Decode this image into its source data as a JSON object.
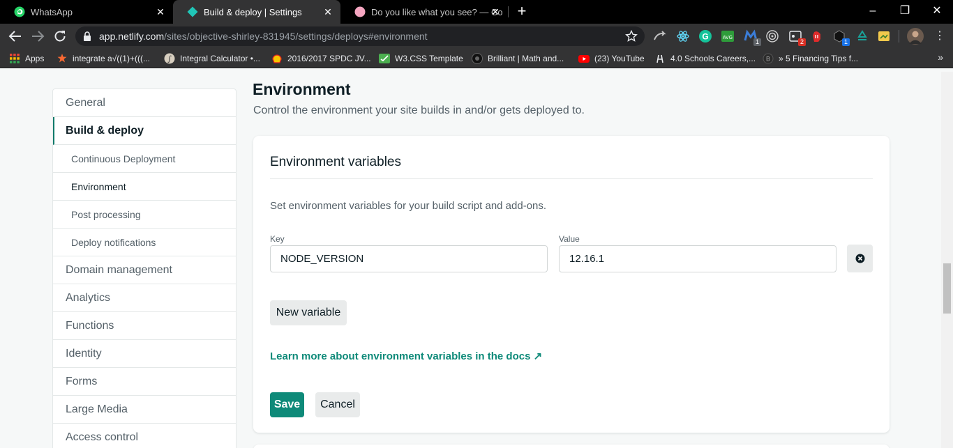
{
  "browser": {
    "tabs": [
      {
        "title": "WhatsApp",
        "active": false,
        "favicon": "whatsapp-icon"
      },
      {
        "title": "Build & deploy | Settings",
        "active": true,
        "favicon": "netlify-icon"
      },
      {
        "title": "Do you like what you see? — Co",
        "active": false,
        "favicon": "pink-dot-icon"
      }
    ],
    "url_host": "app.netlify.com",
    "url_path": "/sites/objective-shirley-831945/settings/deploys#environment",
    "bookmarks": [
      {
        "label": "Apps",
        "icon": "apps-grid-icon"
      },
      {
        "label": "integrate a√((1)+(((...",
        "icon": "wolfram-icon"
      },
      {
        "label": "Integral Calculator •...",
        "icon": "integral-icon"
      },
      {
        "label": "2016/2017 SPDC JV...",
        "icon": "shell-icon"
      },
      {
        "label": "W3.CSS Template",
        "icon": "w3css-icon"
      },
      {
        "label": "Brilliant | Math and...",
        "icon": "brilliant-icon"
      },
      {
        "label": "(23) YouTube",
        "icon": "youtube-icon"
      },
      {
        "label": "4.0 Schools Careers,...",
        "icon": "schools-icon"
      },
      {
        "label": "» 5 Financing Tips f...",
        "icon": "bitcoin-icon"
      }
    ],
    "extension_badges": {
      "ext1": "1",
      "ext2": "2",
      "ext3": "1"
    }
  },
  "sidebar": {
    "items": [
      {
        "label": "General",
        "type": "top"
      },
      {
        "label": "Build & deploy",
        "type": "active"
      },
      {
        "label": "Continuous Deployment",
        "type": "sub"
      },
      {
        "label": "Environment",
        "type": "sub-current"
      },
      {
        "label": "Post processing",
        "type": "sub"
      },
      {
        "label": "Deploy notifications",
        "type": "sub"
      },
      {
        "label": "Domain management",
        "type": "top"
      },
      {
        "label": "Analytics",
        "type": "top"
      },
      {
        "label": "Functions",
        "type": "top"
      },
      {
        "label": "Identity",
        "type": "top"
      },
      {
        "label": "Forms",
        "type": "top"
      },
      {
        "label": "Large Media",
        "type": "top"
      },
      {
        "label": "Access control",
        "type": "top"
      }
    ]
  },
  "section": {
    "title": "Environment",
    "description": "Control the environment your site builds in and/or gets deployed to."
  },
  "card": {
    "title": "Environment variables",
    "description": "Set environment variables for your build script and add-ons.",
    "key_label": "Key",
    "value_label": "Value",
    "key_value": "NODE_VERSION",
    "value_value": "12.16.1",
    "new_variable_label": "New variable",
    "docs_link": "Learn more about environment variables in the docs ↗",
    "save_label": "Save",
    "cancel_label": "Cancel"
  },
  "colors": {
    "accent": "#0e8a79",
    "text": "#0e1e25",
    "muted": "#546068",
    "browser_dark": "#333334"
  }
}
